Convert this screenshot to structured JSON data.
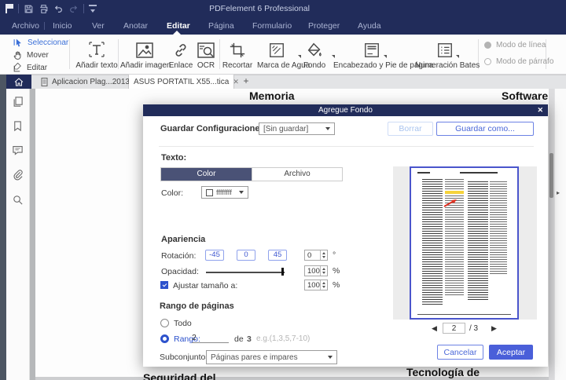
{
  "titlebar": {
    "title": "PDFelement 6 Professional"
  },
  "menu": {
    "items": [
      "Archivo",
      "Inicio",
      "Ver",
      "Anotar",
      "Editar",
      "Página",
      "Formulario",
      "Proteger",
      "Ayuda"
    ],
    "active": "Editar"
  },
  "ribbon": {
    "select_tools": [
      "Seleccionar",
      "Mover",
      "Editar"
    ],
    "buttons": [
      "Añadir texto",
      "Añadir imagen",
      "Enlace",
      "OCR",
      "Recortar",
      "Marca de Agua",
      "Fondo",
      "Encabezado y Pie de página",
      "Numeración Bates"
    ],
    "modes": [
      "Modo de línea",
      "Modo de párrafo"
    ]
  },
  "tabs": {
    "tab1": "Aplicacion Plag...2013",
    "tab2": "ASUS PORTATIL X55...tica"
  },
  "document": {
    "top_left": "Memoria",
    "top_right": "Software",
    "bottom_left": "Seguridad del",
    "bottom_right": "Tecnología de"
  },
  "dialog": {
    "title": "Agregue Fondo",
    "save_config_label": "Guardar Configuraciones:",
    "save_config_value": "[Sin guardar]",
    "borrar": "Borrar",
    "guardar_como": "Guardar como...",
    "texto_label": "Texto:",
    "tab_color": "Color",
    "tab_archivo": "Archivo",
    "color_label": "Color:",
    "color_value": "ffffffff",
    "apariencia": "Apariencia",
    "rotacion_label": "Rotación:",
    "rot_presets": [
      "-45",
      "0",
      "45"
    ],
    "rot_value": "0",
    "degree": "°",
    "opacidad_label": "Opacidad:",
    "opacidad_value": "100",
    "percent": "%",
    "ajustar_label": "Ajustar tamaño a:",
    "ajustar_value": "100",
    "rango_title": "Rango de páginas",
    "todo": "Todo",
    "rango_label": "Rango:",
    "rango_value": "2",
    "de_label": "de",
    "total_pages": "3",
    "hint": "e.g.(1,3,5,7-10)",
    "subconjuntos_label": "Subconjuntos",
    "subconjuntos_value": "Páginas pares e impares",
    "preview_page": "2",
    "preview_total": "/ 3",
    "cancelar": "Cancelar",
    "aceptar": "Aceptar"
  },
  "glyphs": {
    "close": "✕",
    "plus": "+",
    "prev": "◀",
    "next": "▶",
    "expand_right": "▸"
  },
  "colors": {
    "navy": "#212c5a",
    "accent_blue": "#4a5fd9",
    "link_blue": "#3a6fd8",
    "preview_border": "#4a55cc",
    "highlight_yellow": "#f5d33c"
  }
}
